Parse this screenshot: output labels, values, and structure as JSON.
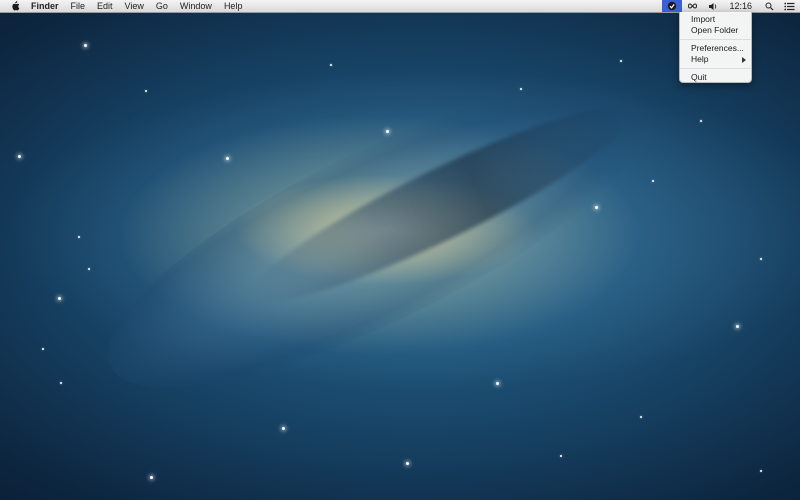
{
  "menubar": {
    "app_name": "Finder",
    "menus": [
      "File",
      "Edit",
      "View",
      "Go",
      "Window",
      "Help"
    ],
    "clock": "12:16",
    "status_icons": [
      "app-status-icon",
      "infinity-icon",
      "volume-icon",
      "spotlight-search-icon",
      "notification-center-icon"
    ]
  },
  "dropdown": {
    "items": {
      "import": "Import",
      "open_folder": "Open Folder",
      "preferences": "Preferences...",
      "help": "Help",
      "quit": "Quit"
    }
  },
  "colors": {
    "menubar_highlight": "#3a5fd6",
    "menubar_bg": "#e6e6e6"
  }
}
